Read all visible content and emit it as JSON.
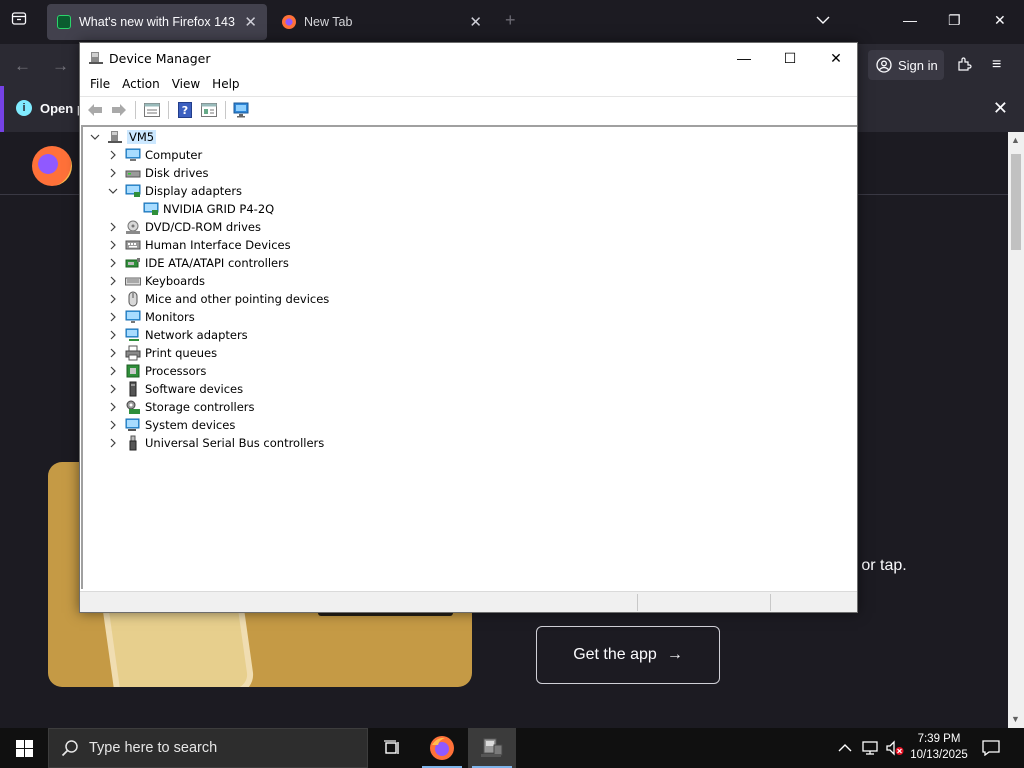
{
  "firefox": {
    "tabs": [
      {
        "label": "What's new with Firefox 143",
        "active": true
      },
      {
        "label": "New Tab",
        "active": false
      }
    ],
    "sign_in_label": "Sign in",
    "notification_text": "Open p",
    "tap_text": "e or tap.",
    "get_app_label": "Get the app"
  },
  "device_manager": {
    "title": "Device Manager",
    "menu": [
      "File",
      "Action",
      "View",
      "Help"
    ],
    "root": "VM5",
    "nodes": [
      {
        "label": "Computer",
        "icon": "computer-icon",
        "expanded": false
      },
      {
        "label": "Disk drives",
        "icon": "disk-drive-icon",
        "expanded": false
      },
      {
        "label": "Display adapters",
        "icon": "display-adapter-icon",
        "expanded": true
      },
      {
        "label": "NVIDIA GRID P4-2Q",
        "icon": "display-adapter-icon",
        "child": true
      },
      {
        "label": "DVD/CD-ROM drives",
        "icon": "dvd-icon",
        "expanded": false
      },
      {
        "label": "Human Interface Devices",
        "icon": "hid-icon",
        "expanded": false
      },
      {
        "label": "IDE ATA/ATAPI controllers",
        "icon": "ide-controller-icon",
        "expanded": false
      },
      {
        "label": "Keyboards",
        "icon": "keyboard-icon",
        "expanded": false
      },
      {
        "label": "Mice and other pointing devices",
        "icon": "mouse-icon",
        "expanded": false
      },
      {
        "label": "Monitors",
        "icon": "monitor-icon",
        "expanded": false
      },
      {
        "label": "Network adapters",
        "icon": "network-adapter-icon",
        "expanded": false
      },
      {
        "label": "Print queues",
        "icon": "printer-icon",
        "expanded": false
      },
      {
        "label": "Processors",
        "icon": "processor-icon",
        "expanded": false
      },
      {
        "label": "Software devices",
        "icon": "software-device-icon",
        "expanded": false
      },
      {
        "label": "Storage controllers",
        "icon": "storage-controller-icon",
        "expanded": false
      },
      {
        "label": "System devices",
        "icon": "system-device-icon",
        "expanded": false
      },
      {
        "label": "Universal Serial Bus controllers",
        "icon": "usb-icon",
        "expanded": false
      }
    ]
  },
  "taskbar": {
    "search_placeholder": "Type here to search",
    "time": "7:39 PM",
    "date": "10/13/2025"
  },
  "colors": {
    "firefox_bg": "#1c1b22",
    "firefox_toolbar": "#2b2a33",
    "accent_purple": "#7542e5",
    "taskbar_bg": "#101010",
    "selection_blue": "#cce8ff"
  }
}
